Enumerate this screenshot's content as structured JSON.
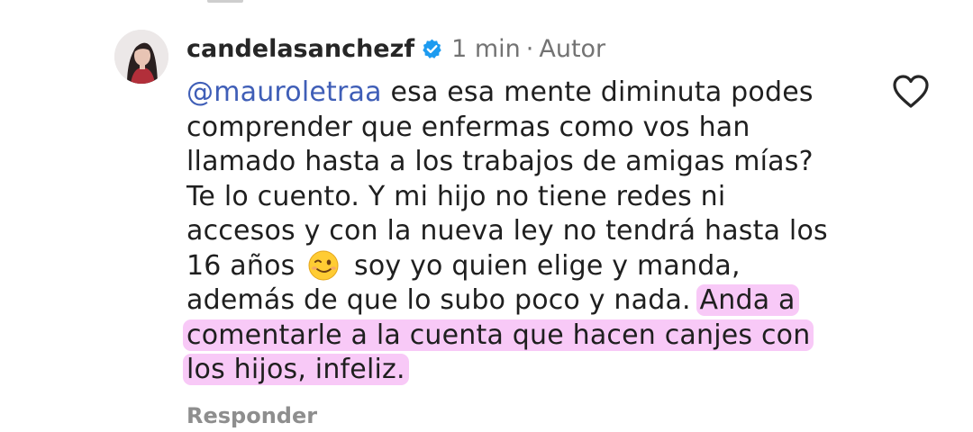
{
  "comment": {
    "username": "candelasanchezf",
    "time": "1 min",
    "separator": "·",
    "author_badge": "Autor",
    "mention": "@mauroletraa",
    "lines": {
      "l1": " esa esa mente diminuta podes",
      "l2": "comprender que enfermas como vos han",
      "l3": "llamado hasta a los trabajos de amigas mías?",
      "l4": "Te lo cuento. Y mi hijo no tiene redes ni",
      "l5": "accesos y con la nueva ley no tendrá hasta los",
      "l6a": "16 años",
      "l6b": "soy yo quien elige y manda,",
      "l7a": "además de que lo subo poco y nada. ",
      "l7b": "Anda a",
      "l8": "comentarle a la cuenta que hacen canjes con",
      "l9": "los hijos, infeliz."
    },
    "emoji": "winking-face",
    "reply_label": "Responder"
  },
  "icons": {
    "verified": "verified-badge-icon",
    "like": "heart-outline-icon"
  },
  "colors": {
    "username": "#262626",
    "meta": "#737373",
    "mention": "#3f5eb7",
    "highlight": "#f8c9f7",
    "reply": "#8e8e8e",
    "verified": "#1d9bf0"
  }
}
